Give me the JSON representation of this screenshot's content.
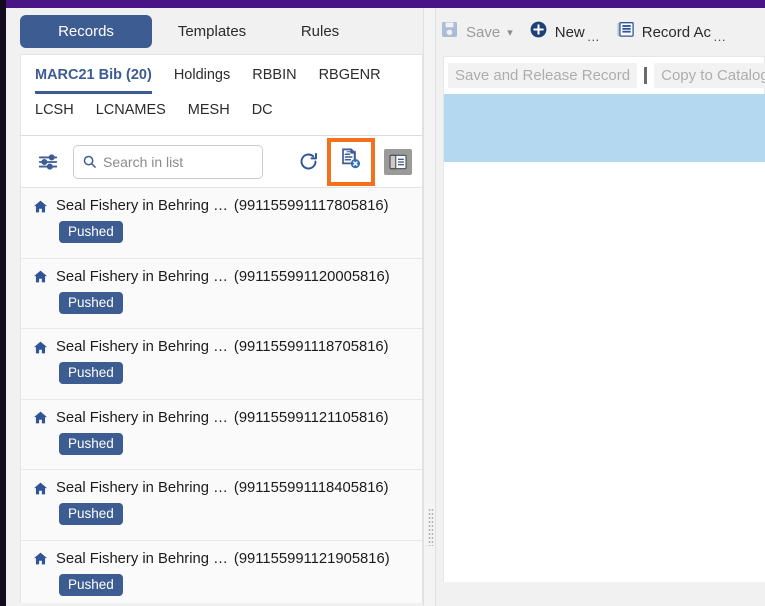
{
  "theme": {
    "accent_purple": "#4b1486",
    "accent_blue": "#3c5c92",
    "highlight_orange": "#f4701b",
    "selection_blue": "#b4d8f0"
  },
  "main_tabs": [
    {
      "label": "Records",
      "active": true
    },
    {
      "label": "Templates",
      "active": false
    },
    {
      "label": "Rules",
      "active": false
    }
  ],
  "sub_tabs_row1": [
    {
      "label": "MARC21 Bib (20)",
      "active": true
    },
    {
      "label": "Holdings",
      "active": false
    },
    {
      "label": "RBBIN",
      "active": false
    },
    {
      "label": "RBGENR",
      "active": false
    }
  ],
  "sub_tabs_row2": [
    {
      "label": "LCSH",
      "active": false
    },
    {
      "label": "LCNAMES",
      "active": false
    },
    {
      "label": "MESH",
      "active": false
    },
    {
      "label": "DC",
      "active": false
    }
  ],
  "list_toolbar": {
    "filter_icon": "sliders-filter-icon",
    "search_placeholder": "Search in list",
    "search_value": "",
    "search_icon": "search-icon",
    "refresh_icon": "refresh-icon",
    "release_record_icon": "document-release-icon",
    "split_view_icon": "split-panel-icon"
  },
  "records": [
    {
      "icon": "home-icon",
      "title": "Seal Fishery in Behring …",
      "id": "(991155991117805816)",
      "badge": "Pushed"
    },
    {
      "icon": "home-icon",
      "title": "Seal Fishery in Behring …",
      "id": "(991155991120005816)",
      "badge": "Pushed"
    },
    {
      "icon": "home-icon",
      "title": "Seal Fishery in Behring …",
      "id": "(991155991118705816)",
      "badge": "Pushed"
    },
    {
      "icon": "home-icon",
      "title": "Seal Fishery in Behring …",
      "id": "(991155991121105816)",
      "badge": "Pushed"
    },
    {
      "icon": "home-icon",
      "title": "Seal Fishery in Behring …",
      "id": "(991155991118405816)",
      "badge": "Pushed"
    },
    {
      "icon": "home-icon",
      "title": "Seal Fishery in Behring …",
      "id": "(991155991121905816)",
      "badge": "Pushed"
    }
  ],
  "top_actions": [
    {
      "label": "Save",
      "icon": "save-icon",
      "disabled": true,
      "caret": true,
      "ellipsis": false
    },
    {
      "label": "New",
      "icon": "plus-circle-icon",
      "disabled": false,
      "caret": false,
      "ellipsis": true
    },
    {
      "label": "Record Ac",
      "icon": "record-actions-icon",
      "disabled": false,
      "caret": false,
      "ellipsis": true
    }
  ],
  "sub_actions": [
    {
      "label": "Save and Release Record"
    },
    {
      "label": "Copy to Catalog"
    }
  ]
}
